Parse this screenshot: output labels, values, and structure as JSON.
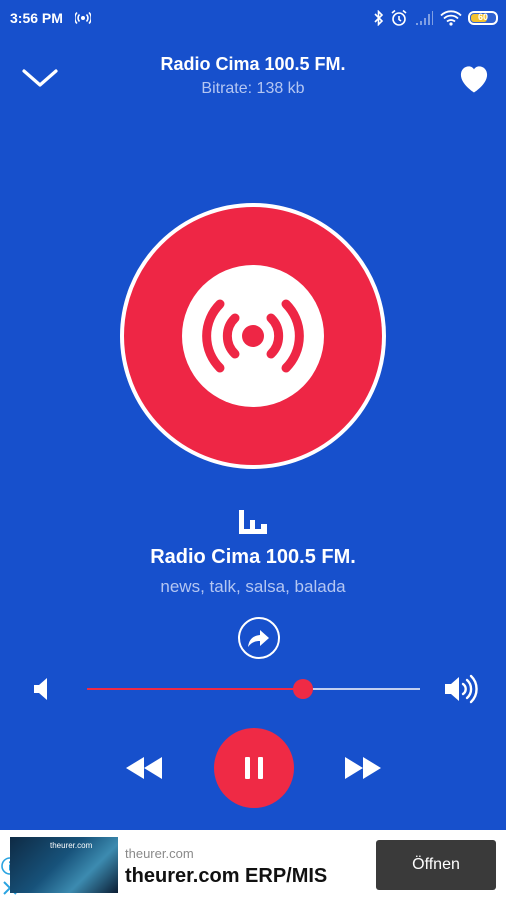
{
  "status_bar": {
    "time": "3:56 PM",
    "battery_level": "60",
    "icons": [
      "broadcast-icon",
      "bluetooth-icon",
      "alarm-icon",
      "signal-icon",
      "wifi-icon",
      "battery-icon"
    ]
  },
  "header": {
    "title": "Radio Cima 100.5 FM.",
    "subtitle": "Bitrate: 138 kb",
    "left_icon": "chevron-down-icon",
    "right_icon": "heart-icon"
  },
  "artwork": {
    "icon": "broadcast-icon",
    "accent_color": "#ee2645",
    "background_color": "#1750cc"
  },
  "station": {
    "name": "Radio Cima 100.5 FM.",
    "genres": "news, talk, salsa, balada",
    "equalizer_icon": "equalizer-icon",
    "share_icon": "share-icon"
  },
  "volume": {
    "level": 0.65,
    "low_icon": "volume-low-icon",
    "high_icon": "volume-high-icon"
  },
  "playback": {
    "state": "playing",
    "controls": [
      "rewind-icon",
      "pause-icon",
      "fast-forward-icon"
    ]
  },
  "ad": {
    "thumbnail_text": "theurer.com",
    "domain": "theurer.com",
    "headline": "theurer.com ERP/MIS",
    "button_label": "Öffnen",
    "info_icon": "info-icon",
    "close_icon": "close-icon"
  }
}
